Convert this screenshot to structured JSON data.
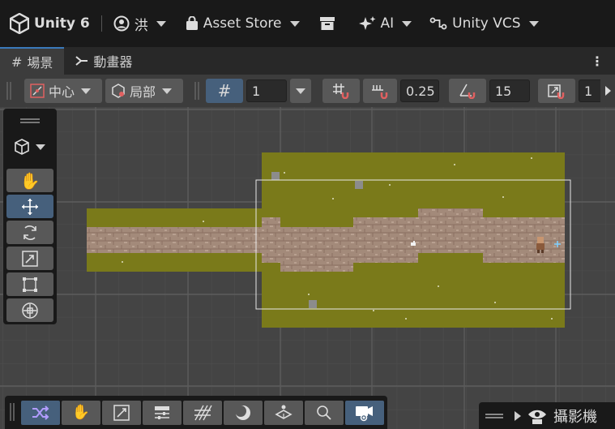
{
  "topbar": {
    "app_name": "Unity 6",
    "account": "洪",
    "asset_store": "Asset Store",
    "ai": "AI",
    "vcs": "Unity VCS"
  },
  "tabs": [
    {
      "label": "場景",
      "icon": "grid-icon",
      "active": true
    },
    {
      "label": "動畫器",
      "icon": "animator-icon",
      "active": false
    }
  ],
  "toolbar": {
    "pivot_label": "中心",
    "space_label": "局部",
    "grid_size": "1",
    "snap_increment": "0.25",
    "rotate_snap": "15",
    "scale_snap": "1"
  },
  "bottom_overlay": {
    "camera_label": "攝影機"
  },
  "colors": {
    "accent": "#46607c",
    "grass": "#7a7a1a",
    "path": "#a08070",
    "scene_bg": "#444444"
  }
}
